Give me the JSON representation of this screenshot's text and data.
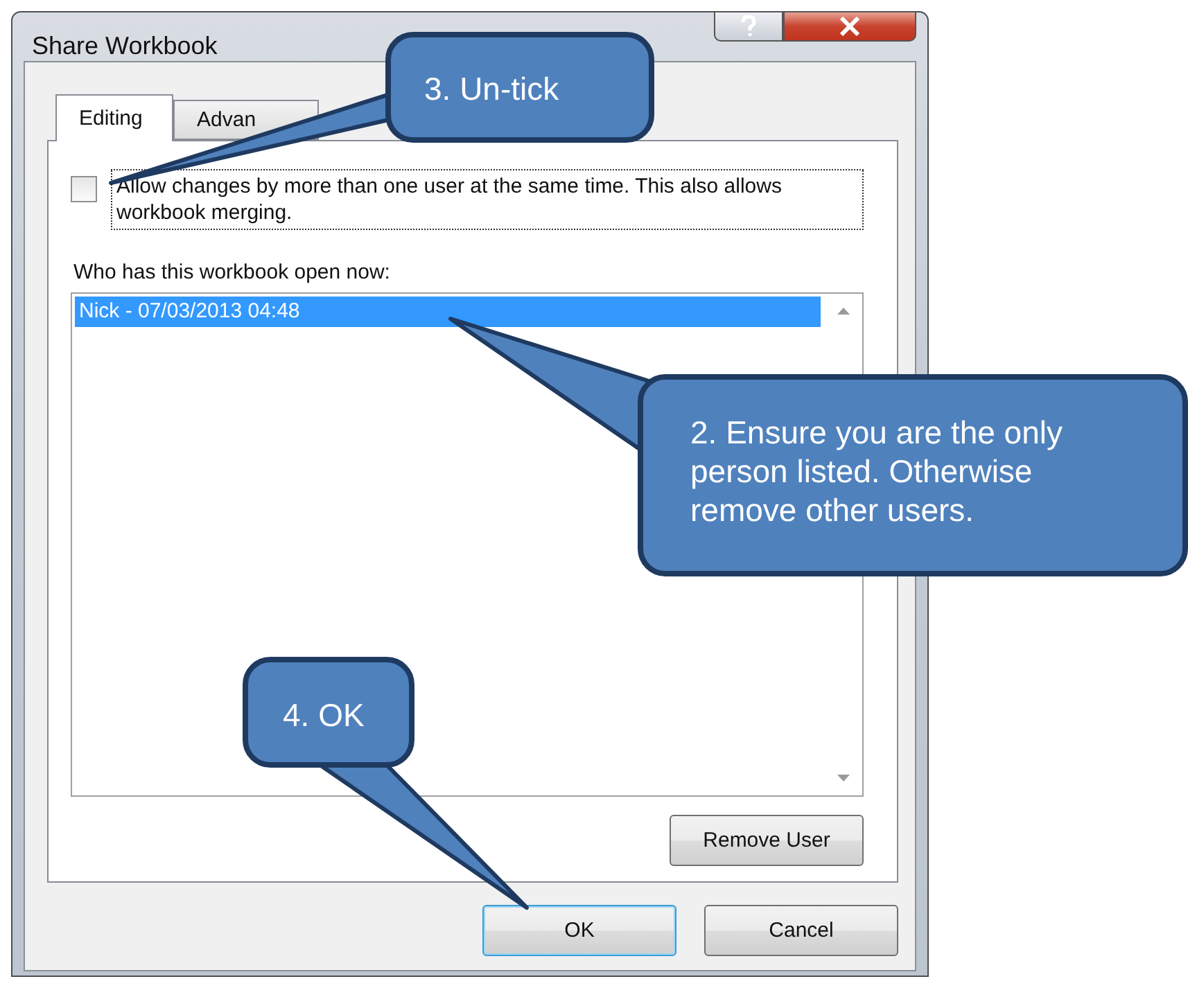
{
  "window": {
    "title": "Share Workbook"
  },
  "tabs": [
    {
      "label": "Editing",
      "selected": true
    },
    {
      "label": "Advan",
      "selected": false
    }
  ],
  "allow_changes": {
    "label": "Allow changes by more than one user at the same time.  This also allows workbook merging.",
    "checked": false
  },
  "users": {
    "label": "Who has this workbook open now:",
    "items": [
      {
        "text": "Nick - 07/03/2013 04:48",
        "selected": true
      }
    ]
  },
  "remove_button": "Remove User",
  "buttons": [
    "OK",
    "Cancel"
  ],
  "callouts": [
    {
      "text": "3. Un-tick"
    },
    {
      "text": "2. Ensure you are the only person listed. Otherwise remove other users."
    },
    {
      "text": "4. OK"
    }
  ]
}
